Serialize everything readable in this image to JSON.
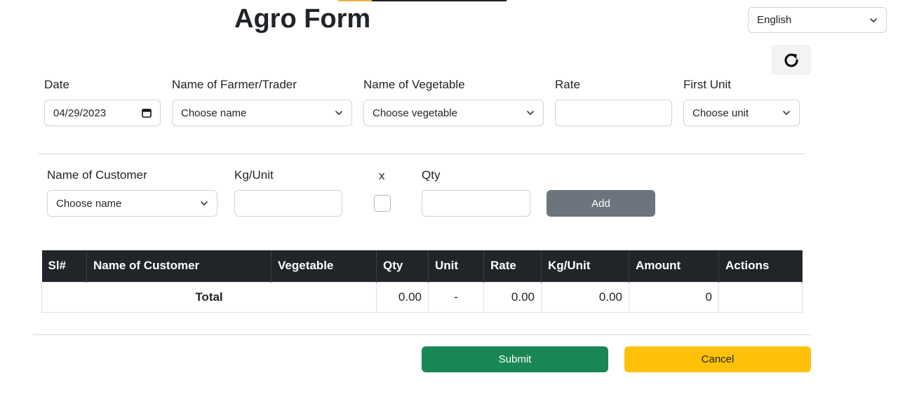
{
  "header": {
    "title": "Agro Form",
    "language": "English"
  },
  "form_row1": {
    "date_label": "Date",
    "date_value": "04/29/2023",
    "farmer_label": "Name of Farmer/Trader",
    "farmer_placeholder": "Choose name",
    "vegetable_label": "Name of Vegetable",
    "vegetable_placeholder": "Choose vegetable",
    "rate_label": "Rate",
    "rate_value": "",
    "first_unit_label": "First Unit",
    "first_unit_placeholder": "Choose unit"
  },
  "form_row2": {
    "customer_label": "Name of Customer",
    "customer_placeholder": "Choose name",
    "kg_unit_label": "Kg/Unit",
    "kg_unit_value": "",
    "x_label": "x",
    "qty_label": "Qty",
    "qty_value": "",
    "add_label": "Add"
  },
  "table": {
    "headers": [
      "Sl#",
      "Name of Customer",
      "Vegetable",
      "Qty",
      "Unit",
      "Rate",
      "Kg/Unit",
      "Amount",
      "Actions"
    ],
    "total_row": {
      "label": "Total",
      "qty": "0.00",
      "unit": "-",
      "rate": "0.00",
      "kg_unit": "0.00",
      "amount": "0",
      "actions": ""
    }
  },
  "actions": {
    "submit_label": "Submit",
    "cancel_label": "Cancel"
  },
  "colors": {
    "submit": "#198754",
    "cancel": "#ffc107",
    "add": "#6c757d",
    "table_header": "#212529"
  }
}
